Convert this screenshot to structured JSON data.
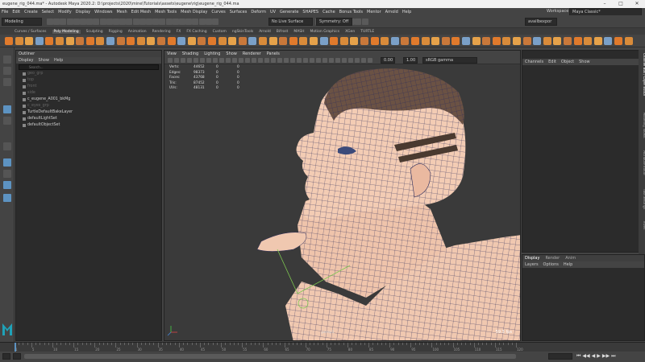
{
  "window": {
    "title": "eugene_rig_044.ma* - Autodesk Maya 2020.2: D:\\projects\\2020\\mine\\Tutorials\\assets\\eugene\\rig\\eugene_rig_044.ma",
    "workspace_label": "Workspace :",
    "workspace_value": "Maya Classic*"
  },
  "menu": [
    "File",
    "Edit",
    "Create",
    "Select",
    "Modify",
    "Display",
    "Windows",
    "Mesh",
    "Edit Mesh",
    "Mesh Tools",
    "Mesh Display",
    "Curves",
    "Surfaces",
    "Deform",
    "UV",
    "Generate",
    "SHAPES",
    "Cache",
    "Bonus Tools",
    "Mentor",
    "Arnold",
    "Help"
  ],
  "statusline": {
    "mode": "Modeling",
    "live_surface": "No Live Surface",
    "symmetry": "Symmetry: Off",
    "user": "availbexpor"
  },
  "shelf_tabs": [
    "Curves / Surfaces",
    "Poly Modeling",
    "Sculpting",
    "Rigging",
    "Animation",
    "Rendering",
    "FX",
    "FX Caching",
    "Custom",
    "ngSkinTools",
    "Arnold",
    "Bifrost",
    "MASH",
    "Motion Graphics",
    "XGen",
    "TURTLE"
  ],
  "shelf_active": "Poly Modeling",
  "outliner": {
    "title": "Outliner",
    "menu": [
      "Display",
      "Show",
      "Help"
    ],
    "search_placeholder": "Search...",
    "items": [
      {
        "label": "geo_grp",
        "dim": true
      },
      {
        "label": "top",
        "dim": true
      },
      {
        "label": "front",
        "dim": true
      },
      {
        "label": "side",
        "dim": true
      },
      {
        "label": "c_eugene_A001_bkMg",
        "dim": false
      },
      {
        "label": "c_eyes_grp",
        "dim": true
      },
      {
        "label": "TurtleDefaultBakeLayer",
        "dim": false
      },
      {
        "label": "defaultLightSet",
        "dim": false
      },
      {
        "label": "defaultObjectSet",
        "dim": false
      }
    ]
  },
  "viewport": {
    "menu": [
      "View",
      "Shading",
      "Lighting",
      "Show",
      "Renderer",
      "Panels"
    ],
    "exposure": "0.00",
    "gamma": "1.00",
    "colorspace": "sRGB gamma",
    "hud": [
      {
        "label": "Verts:",
        "a": "44652",
        "b": "0",
        "c": "0"
      },
      {
        "label": "Edges:",
        "a": "98373",
        "b": "0",
        "c": "0"
      },
      {
        "label": "Faces:",
        "a": "43768",
        "b": "0",
        "c": "0"
      },
      {
        "label": "Tris:",
        "a": "87452",
        "b": "0",
        "c": "0"
      },
      {
        "label": "UVs:",
        "a": "48131",
        "b": "0",
        "c": "0"
      }
    ],
    "fps": "59.3 fps",
    "camera": "persp1"
  },
  "channelbox": {
    "menu": [
      "Channels",
      "Edit",
      "Object",
      "Show"
    ],
    "side_tabs": [
      "Channel Box / Layer Editor",
      "Modeling Toolkit",
      "Attribute Editor",
      "Tool Settings",
      "XGen"
    ]
  },
  "layers": {
    "tabs": [
      "Display",
      "Render",
      "Anim"
    ],
    "active": "Display",
    "menu": [
      "Layers",
      "Options",
      "Help"
    ]
  },
  "timeline": {
    "labels": [
      "1",
      "5",
      "10",
      "15",
      "20",
      "25",
      "30",
      "35",
      "40",
      "45",
      "50",
      "55",
      "60",
      "65",
      "70",
      "75",
      "80",
      "85",
      "90",
      "95",
      "100",
      "105",
      "110",
      "115",
      "120"
    ],
    "current": "1"
  },
  "colors": {
    "accent": "#5d93c2",
    "mesh_wire": "#2a2a5a",
    "skin": "#f0c8b0",
    "hair": "#6b5244"
  }
}
